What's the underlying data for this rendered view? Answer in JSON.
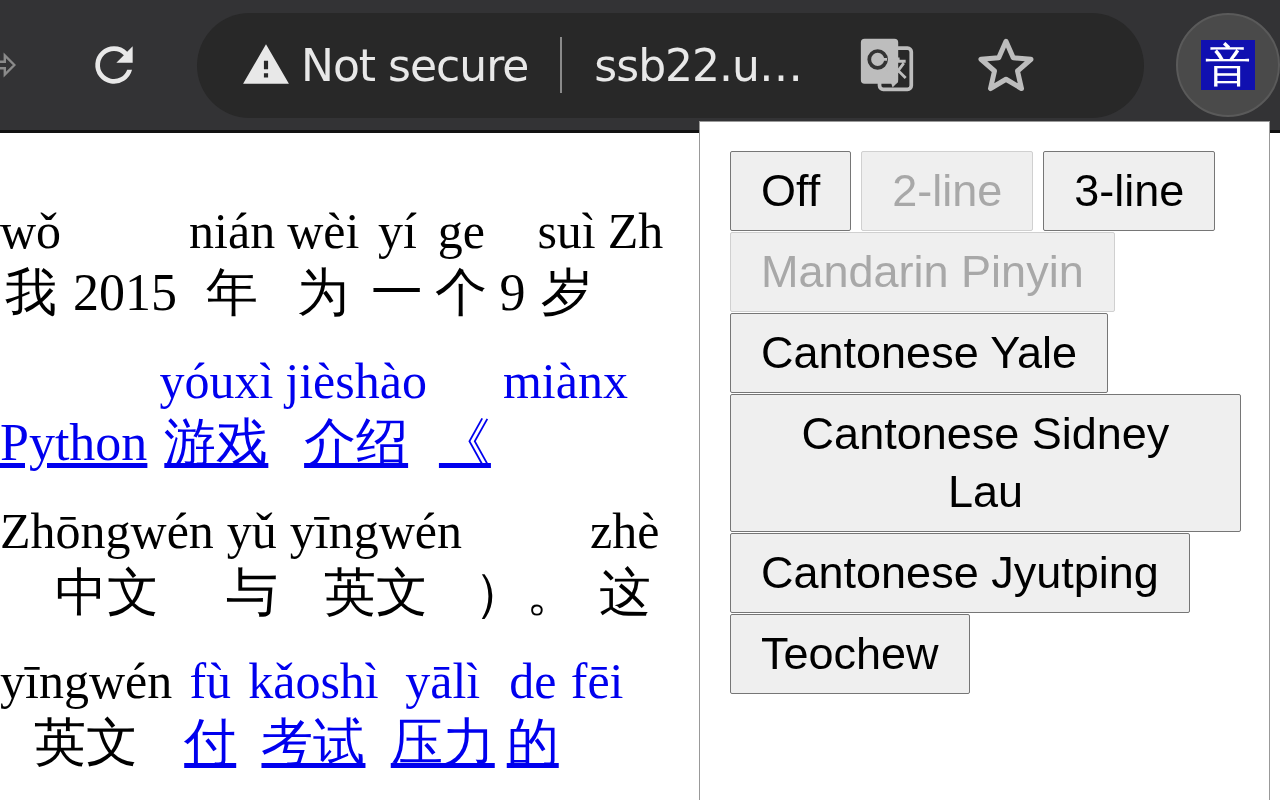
{
  "toolbar": {
    "security_label": "Not secure",
    "url": "ssb22.u…",
    "extension_badge": "音"
  },
  "page": {
    "lines": [
      {
        "segments": [
          {
            "pinyin": "wǒ",
            "hanzi": "我",
            "link": false
          },
          {
            "hanzi": "2015",
            "link": false
          },
          {
            "pinyin": "nián",
            "hanzi": "年",
            "link": false
          },
          {
            "pinyin": "wèi",
            "hanzi": "为",
            "link": false
          },
          {
            "pinyin": "yí",
            "hanzi": "一",
            "link": false
          },
          {
            "pinyin": "ge",
            "hanzi": "个",
            "link": false
          },
          {
            "hanzi": "9",
            "link": false
          },
          {
            "pinyin": "suì",
            "hanzi": "岁",
            "link": false
          },
          {
            "pinyin": "Zh",
            "link": false
          }
        ]
      },
      {
        "segments": [
          {
            "hanzi": "Python",
            "link": true
          },
          {
            "pinyin": "yóuxì",
            "hanzi": "游戏",
            "link": true
          },
          {
            "pinyin": "jièshào",
            "hanzi": "介绍",
            "link": true
          },
          {
            "hanzi": "《",
            "link": true
          },
          {
            "pinyin": "miànx",
            "link": true
          }
        ]
      },
      {
        "segments": [
          {
            "pinyin": "Zhōngwén",
            "hanzi": "中文",
            "link": false
          },
          {
            "pinyin": "yǔ",
            "hanzi": "与",
            "link": false
          },
          {
            "pinyin": "yīngwén",
            "hanzi": "英文",
            "link": false
          },
          {
            "hanzi": "）。",
            "link": false
          },
          {
            "pinyin": "zhè",
            "hanzi": "这",
            "link": false
          }
        ]
      },
      {
        "segments": [
          {
            "pinyin": "yīngwén",
            "hanzi": "英文",
            "link": false
          },
          {
            "pinyin": "fù",
            "hanzi": "付",
            "link": true
          },
          {
            "pinyin": "kǎoshì",
            "hanzi": "考试",
            "link": true
          },
          {
            "pinyin": "yālì",
            "hanzi": "压力",
            "link": true
          },
          {
            "pinyin": "de",
            "hanzi": "的",
            "link": true
          },
          {
            "pinyin": "fēi",
            "link": true
          }
        ]
      }
    ]
  },
  "popup": {
    "buttons": [
      {
        "label": "Off",
        "disabled": false
      },
      {
        "label": "2-line",
        "disabled": true
      },
      {
        "label": "3-line",
        "disabled": false
      },
      {
        "label": "Mandarin Pinyin",
        "disabled": true
      },
      {
        "label": "Cantonese Yale",
        "disabled": false
      },
      {
        "label": "Cantonese Sidney Lau",
        "disabled": false
      },
      {
        "label": "Cantonese Jyutping",
        "disabled": false
      },
      {
        "label": "Teochew",
        "disabled": false
      }
    ]
  }
}
